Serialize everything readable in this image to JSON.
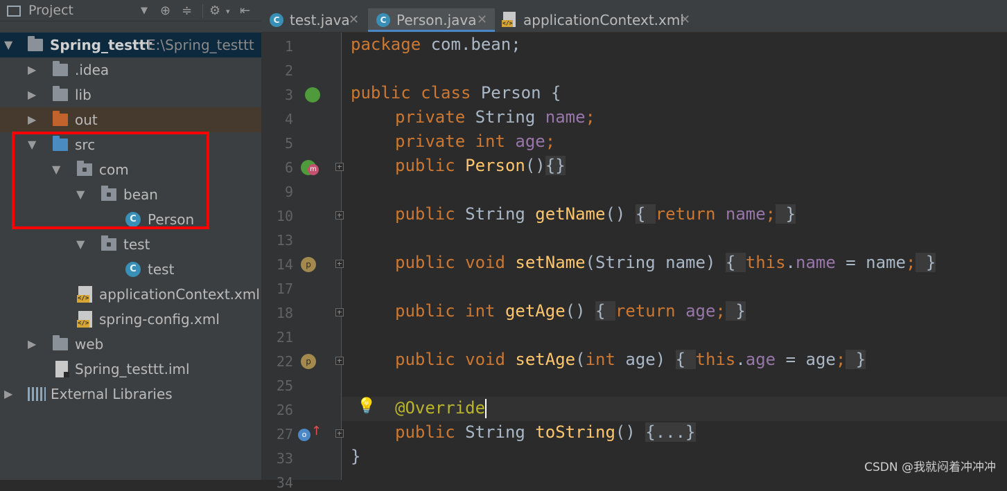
{
  "project": {
    "title": "Project",
    "root_name": "Spring_testtt",
    "root_path": "E:\\Spring_testtt",
    "items": [
      {
        "label": ".idea"
      },
      {
        "label": "lib"
      },
      {
        "label": "out"
      },
      {
        "label": "src"
      },
      {
        "label": "com"
      },
      {
        "label": "bean"
      },
      {
        "label": "Person"
      },
      {
        "label": "test"
      },
      {
        "label": "test"
      },
      {
        "label": "applicationContext.xml"
      },
      {
        "label": "spring-config.xml"
      },
      {
        "label": "web"
      },
      {
        "label": "Spring_testtt.iml"
      },
      {
        "label": "External Libraries"
      }
    ]
  },
  "tabs": [
    {
      "label": "test.java",
      "active": false
    },
    {
      "label": "Person.java",
      "active": true
    },
    {
      "label": "applicationContext.xml",
      "active": false
    }
  ],
  "gutter": {
    "line_numbers": [
      "1",
      "2",
      "3",
      "4",
      "5",
      "6",
      "9",
      "10",
      "13",
      "14",
      "17",
      "18",
      "21",
      "22",
      "25",
      "26",
      "27",
      "33",
      "34"
    ]
  },
  "code": {
    "l1_kw": "package",
    "l1_rest": " com.bean;",
    "l3_kw": "public class",
    "l3_rest": " Person {",
    "l4_kw": "private",
    "l4_type": " String ",
    "l4_field": "name",
    "l4_semi": ";",
    "l5_kw": "private int",
    "l5_field": " age",
    "l5_semi": ";",
    "l6_kw": "public",
    "l6_fn": " Person",
    "l6_paren": "()",
    "l6_fold": "{}",
    "l10_kw": "public",
    "l10_type": " String ",
    "l10_fn": "getName",
    "l10_paren": "() ",
    "l10_fold_open": "{ ",
    "l10_ret": "return",
    "l10_field": " name",
    "l10_semi": ";",
    "l10_fold_close": " }",
    "l14_kw": "public void",
    "l14_fn": " setName",
    "l14_params": "(String name) ",
    "l14_fold_open": "{ ",
    "l14_this": "this",
    "l14_dot": ".",
    "l14_field": "name",
    "l14_assign": " = name",
    "l14_semi": ";",
    "l14_fold_close": " }",
    "l18_kw": "public int",
    "l18_fn": " getAge",
    "l18_paren": "() ",
    "l18_fold_open": "{ ",
    "l18_ret": "return",
    "l18_field": " age",
    "l18_semi": ";",
    "l18_fold_close": " }",
    "l22_kw": "public void",
    "l22_fn": " setAge",
    "l22_p1": "(",
    "l22_int": "int",
    "l22_p2": " age) ",
    "l22_fold_open": "{ ",
    "l22_this": "this",
    "l22_dot": ".",
    "l22_field": "age",
    "l22_assign": " = age",
    "l22_semi": ";",
    "l22_fold_close": " }",
    "l26_ann": "@Override",
    "l27_kw": "public",
    "l27_type": " String ",
    "l27_fn": "toString",
    "l27_paren": "() ",
    "l27_fold": "{...}",
    "l33": "}"
  },
  "watermark": "CSDN @我就闷着冲冲冲",
  "colors": {
    "keyword": "#cc7832",
    "field": "#9876aa",
    "method": "#ffc66d",
    "annotation": "#bbb529",
    "highlight_box": "#ff0000"
  }
}
